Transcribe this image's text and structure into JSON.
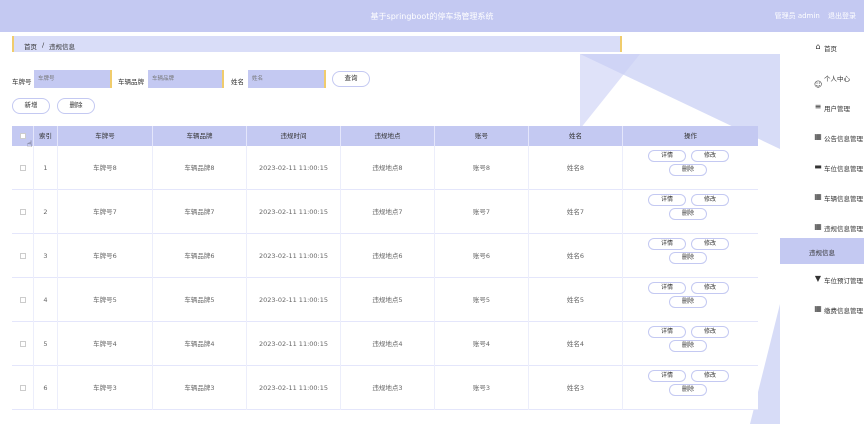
{
  "header": {
    "title": "基于springboot的停车场管理系统",
    "admin_label": "管理员 admin",
    "logout": "退出登录"
  },
  "breadcrumb": {
    "home": "首页",
    "sep": "/",
    "current": "违规信息"
  },
  "search": {
    "plate_label": "车牌号",
    "plate_placeholder": "车牌号",
    "brand_label": "车辆品牌",
    "brand_placeholder": "车辆品牌",
    "name_label": "姓名",
    "name_placeholder": "姓名",
    "query": "查询"
  },
  "toolbar": {
    "add": "新增",
    "delete": "删除"
  },
  "table": {
    "headers": [
      "索引",
      "车牌号",
      "车辆品牌",
      "违规时间",
      "违规地点",
      "账号",
      "姓名",
      "操作"
    ],
    "rows": [
      {
        "idx": "1",
        "plate": "车牌号8",
        "brand": "车辆品牌8",
        "time": "2023-02-11 11:00:15",
        "place": "违规地点8",
        "account": "账号8",
        "name": "姓名8"
      },
      {
        "idx": "2",
        "plate": "车牌号7",
        "brand": "车辆品牌7",
        "time": "2023-02-11 11:00:15",
        "place": "违规地点7",
        "account": "账号7",
        "name": "姓名7"
      },
      {
        "idx": "3",
        "plate": "车牌号6",
        "brand": "车辆品牌6",
        "time": "2023-02-11 11:00:15",
        "place": "违规地点6",
        "account": "账号6",
        "name": "姓名6"
      },
      {
        "idx": "4",
        "plate": "车牌号5",
        "brand": "车辆品牌5",
        "time": "2023-02-11 11:00:15",
        "place": "违规地点5",
        "account": "账号5",
        "name": "姓名5"
      },
      {
        "idx": "5",
        "plate": "车牌号4",
        "brand": "车辆品牌4",
        "time": "2023-02-11 11:00:15",
        "place": "违规地点4",
        "account": "账号4",
        "name": "姓名4"
      },
      {
        "idx": "6",
        "plate": "车牌号3",
        "brand": "车辆品牌3",
        "time": "2023-02-11 11:00:15",
        "place": "违规地点3",
        "account": "账号3",
        "name": "姓名3"
      }
    ],
    "actions": {
      "detail": "详情",
      "edit": "修改",
      "delete": "删除"
    }
  },
  "sidebar": {
    "items": [
      {
        "label": "首页",
        "icon": "home-icon"
      },
      {
        "label": "个人中心",
        "icon": "user-icon"
      },
      {
        "label": "用户管理",
        "icon": "list-icon"
      },
      {
        "label": "公告信息管理",
        "icon": "grid-icon"
      },
      {
        "label": "车位信息管理",
        "icon": "car-icon"
      },
      {
        "label": "车辆信息管理",
        "icon": "grid-icon"
      },
      {
        "label": "违规信息管理",
        "icon": "grid-icon"
      },
      {
        "label": "违规信息",
        "icon": "",
        "sub": true,
        "active": true
      },
      {
        "label": "车位预订管理",
        "icon": "pin-icon"
      },
      {
        "label": "缴费信息管理",
        "icon": "grid-icon"
      }
    ]
  },
  "colors": {
    "accent": "#c4c9f2",
    "highlight": "#f0cc6c"
  }
}
